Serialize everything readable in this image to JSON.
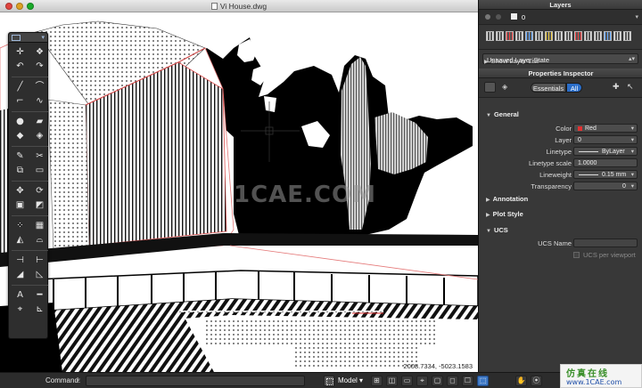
{
  "window": {
    "title": "Vi House.dwg"
  },
  "canvas": {
    "coordinates": "2008.7334, -5023.1583",
    "watermark": "1CAE.COM"
  },
  "tool_palette": {
    "tools": [
      {
        "glyph": "✛",
        "name": "point-icon"
      },
      {
        "glyph": "❖",
        "name": "cloud-icon"
      },
      {
        "glyph": "↶",
        "name": "undo-icon"
      },
      {
        "glyph": "↷",
        "name": "redo-icon"
      },
      {
        "glyph": "╱",
        "name": "line-icon"
      },
      {
        "glyph": "⌒",
        "name": "arc-icon"
      },
      {
        "glyph": "⌐",
        "name": "polyline-icon"
      },
      {
        "glyph": "∿",
        "name": "spline-icon"
      },
      {
        "glyph": "●",
        "name": "circle-icon"
      },
      {
        "glyph": "▰",
        "name": "rectangle-icon"
      },
      {
        "glyph": "◆",
        "name": "hatch-icon"
      },
      {
        "glyph": "◈",
        "name": "gradient-icon"
      },
      {
        "glyph": "✎",
        "name": "edit-icon"
      },
      {
        "glyph": "✂",
        "name": "trim-icon"
      },
      {
        "glyph": "⧉",
        "name": "copy-icon"
      },
      {
        "glyph": "▭",
        "name": "erase-icon"
      },
      {
        "glyph": "✥",
        "name": "move-icon"
      },
      {
        "glyph": "⟳",
        "name": "rotate-icon"
      },
      {
        "glyph": "▣",
        "name": "scale-icon"
      },
      {
        "glyph": "◩",
        "name": "mirror-icon"
      },
      {
        "glyph": "⁘",
        "name": "array-icon"
      },
      {
        "glyph": "▦",
        "name": "grid-array-icon"
      },
      {
        "glyph": "◭",
        "name": "stretch-icon"
      },
      {
        "glyph": "⌓",
        "name": "fillet-icon"
      },
      {
        "glyph": "⊣",
        "name": "extend-icon"
      },
      {
        "glyph": "⊢",
        "name": "break-icon"
      },
      {
        "glyph": "◢",
        "name": "chamfer-icon"
      },
      {
        "glyph": "◺",
        "name": "offset-icon"
      },
      {
        "glyph": "A",
        "name": "text-icon"
      },
      {
        "glyph": "━",
        "name": "dimension-icon"
      },
      {
        "glyph": "⌖",
        "name": "locate-icon"
      },
      {
        "glyph": "⊾",
        "name": "measure-icon"
      }
    ]
  },
  "status_bar": {
    "command_label": "Command:",
    "layout_tab": "Model",
    "buttons": [
      "⊞",
      "◫",
      "▭",
      "⌖",
      "▢",
      "◻",
      "☐",
      "⬚"
    ],
    "right_buttons": [
      "✋",
      "⦿"
    ]
  },
  "layers": {
    "header": "Layers",
    "current_layer": "0",
    "layer_state": "Unsaved Layer State",
    "show_list": "Show Layer List"
  },
  "inspector": {
    "header": "Properties Inspector",
    "tabs": [
      "Essentials",
      "All"
    ],
    "active_tab": "All",
    "general": {
      "title": "General",
      "props": [
        {
          "label": "Color",
          "value": "Red"
        },
        {
          "label": "Layer",
          "value": "0"
        },
        {
          "label": "Linetype",
          "value": "ByLayer"
        },
        {
          "label": "Linetype scale",
          "value": "1.0000"
        },
        {
          "label": "Lineweight",
          "value": "0.15 mm"
        },
        {
          "label": "Transparency",
          "value": "0"
        }
      ]
    },
    "annotation": "Annotation",
    "plot_style": "Plot Style",
    "ucs": {
      "title": "UCS",
      "ucs_name_label": "UCS Name",
      "per_viewport": "UCS per viewport"
    }
  },
  "stamp": {
    "cn": "仿真在线",
    "url": "www.1CAE.com"
  },
  "colors": {
    "accent": "#2a6dc8",
    "color_swatch": "#e03030",
    "panel_bg": "#383838"
  }
}
